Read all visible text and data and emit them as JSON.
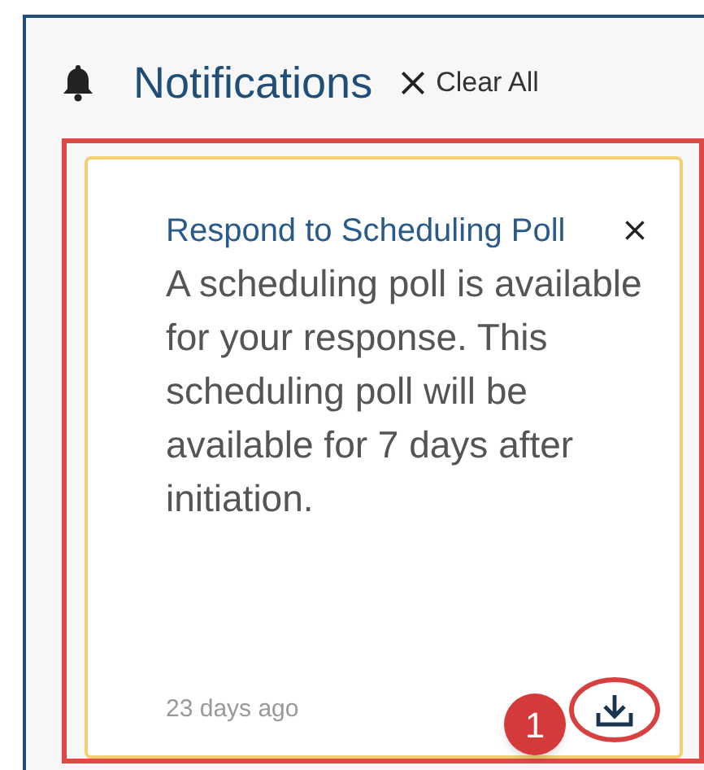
{
  "header": {
    "title": "Notifications",
    "clear_all": "Clear All"
  },
  "notifications": [
    {
      "title": "Respond to Scheduling Poll",
      "body": "A scheduling poll is available for your response. This scheduling poll will be available for 7 days after initiation.",
      "time": "23 days ago",
      "highlighted": true,
      "callout": "1"
    }
  ]
}
